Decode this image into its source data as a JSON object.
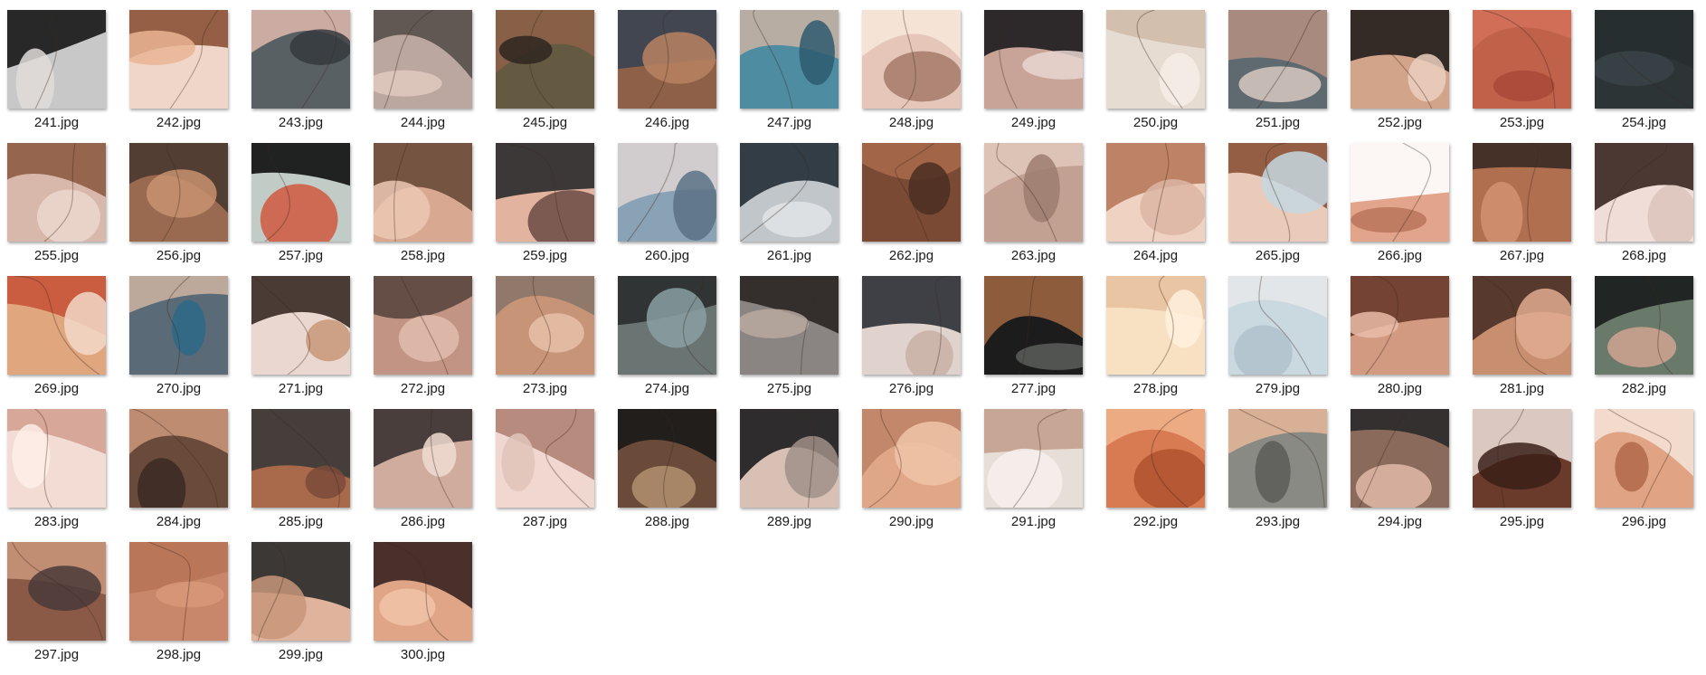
{
  "files": [
    {
      "name": "241.jpg",
      "colors": [
        "#c8c8c8",
        "#161616",
        "#e0dcd8"
      ],
      "icon": "face-thumbnail-icon"
    },
    {
      "name": "242.jpg",
      "colors": [
        "#f0d6c8",
        "#8a5236",
        "#eab494"
      ],
      "icon": "face-thumbnail-icon"
    },
    {
      "name": "243.jpg",
      "colors": [
        "#596064",
        "#d8b4a8",
        "#353a3e"
      ],
      "icon": "face-thumbnail-icon"
    },
    {
      "name": "244.jpg",
      "colors": [
        "#bca6a0",
        "#57504a",
        "#e0cac0"
      ],
      "icon": "face-thumbnail-icon"
    },
    {
      "name": "245.jpg",
      "colors": [
        "#645a42",
        "#8b6048",
        "#2e2620"
      ],
      "icon": "face-thumbnail-icon"
    },
    {
      "name": "246.jpg",
      "colors": [
        "#8e6048",
        "#3a4452",
        "#b88262"
      ],
      "icon": "face-thumbnail-icon"
    },
    {
      "name": "247.jpg",
      "colors": [
        "#4e8ca2",
        "#c4b0a2",
        "#2e5a6e"
      ],
      "icon": "face-thumbnail-icon"
    },
    {
      "name": "248.jpg",
      "colors": [
        "#e6c6b8",
        "#f6e6d8",
        "#a47a6a"
      ],
      "icon": "face-thumbnail-icon"
    },
    {
      "name": "249.jpg",
      "colors": [
        "#c8a498",
        "#1c1c1e",
        "#e8d6d0"
      ],
      "icon": "face-thumbnail-icon"
    },
    {
      "name": "250.jpg",
      "colors": [
        "#e6dcd2",
        "#cfbba8",
        "#f6eee8"
      ],
      "icon": "face-thumbnail-icon"
    },
    {
      "name": "251.jpg",
      "colors": [
        "#5e6a70",
        "#b08e80",
        "#d8c8c0"
      ],
      "icon": "face-thumbnail-icon"
    },
    {
      "name": "252.jpg",
      "colors": [
        "#d2a48a",
        "#221e1c",
        "#ecd0c0"
      ],
      "icon": "face-thumbnail-icon"
    },
    {
      "name": "253.jpg",
      "colors": [
        "#c0614a",
        "#d2705a",
        "#a84a38"
      ],
      "icon": "face-thumbnail-icon"
    },
    {
      "name": "254.jpg",
      "colors": [
        "#2c3436",
        "#262e30",
        "#3a4448"
      ],
      "icon": "face-thumbnail-icon"
    },
    {
      "name": "255.jpg",
      "colors": [
        "#d8b8aa",
        "#8e5c44",
        "#ecd6cc"
      ],
      "icon": "face-thumbnail-icon"
    },
    {
      "name": "256.jpg",
      "colors": [
        "#9a6a50",
        "#4a3a30",
        "#c89270"
      ],
      "icon": "face-thumbnail-icon"
    },
    {
      "name": "257.jpg",
      "colors": [
        "#c2ccc6",
        "#0e0e0e",
        "#d0573e"
      ],
      "icon": "face-thumbnail-icon"
    },
    {
      "name": "258.jpg",
      "colors": [
        "#d8a890",
        "#6a4a3a",
        "#ecc8b4"
      ],
      "icon": "face-thumbnail-icon"
    },
    {
      "name": "259.jpg",
      "colors": [
        "#e2b4a0",
        "#2a2a2c",
        "#6a4a44"
      ],
      "icon": "face-thumbnail-icon"
    },
    {
      "name": "260.jpg",
      "colors": [
        "#8aa2b6",
        "#d8d2d0",
        "#5a7286"
      ],
      "icon": "face-thumbnail-icon"
    },
    {
      "name": "261.jpg",
      "colors": [
        "#c0c6ca",
        "#242e36",
        "#e0e4e6"
      ],
      "icon": "face-thumbnail-icon"
    },
    {
      "name": "262.jpg",
      "colors": [
        "#7a4a34",
        "#a6684a",
        "#4a2e22"
      ],
      "icon": "face-thumbnail-icon"
    },
    {
      "name": "263.jpg",
      "colors": [
        "#c2a092",
        "#e0c6ba",
        "#9c7c70"
      ],
      "icon": "face-thumbnail-icon"
    },
    {
      "name": "264.jpg",
      "colors": [
        "#f0d2c2",
        "#b87a5c",
        "#dcb6a4"
      ],
      "icon": "face-thumbnail-icon"
    },
    {
      "name": "265.jpg",
      "colors": [
        "#eacab8",
        "#8a5236",
        "#c6d8e0"
      ],
      "icon": "face-thumbnail-icon"
    },
    {
      "name": "266.jpg",
      "colors": [
        "#e2a48a",
        "#ffffff",
        "#b8765a"
      ],
      "icon": "face-thumbnail-icon"
    },
    {
      "name": "267.jpg",
      "colors": [
        "#b07050",
        "#3a2a24",
        "#d29272"
      ],
      "icon": "face-thumbnail-icon"
    },
    {
      "name": "268.jpg",
      "colors": [
        "#f0ddd8",
        "#3a2620",
        "#dcc4bc"
      ],
      "icon": "face-thumbnail-icon"
    },
    {
      "name": "269.jpg",
      "colors": [
        "#e0a67e",
        "#c8543a",
        "#f2d8c8"
      ],
      "icon": "face-thumbnail-icon"
    },
    {
      "name": "270.jpg",
      "colors": [
        "#5a6a76",
        "#c8b0a0",
        "#2e6888"
      ],
      "icon": "face-thumbnail-icon"
    },
    {
      "name": "271.jpg",
      "colors": [
        "#ead8d0",
        "#3a2a24",
        "#c89878"
      ],
      "icon": "face-thumbnail-icon"
    },
    {
      "name": "272.jpg",
      "colors": [
        "#c29484",
        "#5a463e",
        "#e0bcac"
      ],
      "icon": "face-thumbnail-icon"
    },
    {
      "name": "273.jpg",
      "colors": [
        "#c89478",
        "#8a7468",
        "#e6c0a8"
      ],
      "icon": "face-thumbnail-icon"
    },
    {
      "name": "274.jpg",
      "colors": [
        "#6a7472",
        "#2a2e2e",
        "#8aa0a4"
      ],
      "icon": "face-thumbnail-icon"
    },
    {
      "name": "275.jpg",
      "colors": [
        "#8a8482",
        "#2a2624",
        "#b8a8a0"
      ],
      "icon": "face-thumbnail-icon"
    },
    {
      "name": "276.jpg",
      "colors": [
        "#e0d2cc",
        "#2e3036",
        "#c8b0a4"
      ],
      "icon": "face-thumbnail-icon"
    },
    {
      "name": "277.jpg",
      "colors": [
        "#1c1c1c",
        "#9a6440",
        "#5a5e5a"
      ],
      "icon": "face-thumbnail-icon"
    },
    {
      "name": "278.jpg",
      "colors": [
        "#f8e0c2",
        "#e8c2a0",
        "#fff0de"
      ],
      "icon": "face-thumbnail-icon"
    },
    {
      "name": "279.jpg",
      "colors": [
        "#cad8e0",
        "#e6e8ea",
        "#b0c2cc"
      ],
      "icon": "face-thumbnail-icon"
    },
    {
      "name": "280.jpg",
      "colors": [
        "#d29a80",
        "#6a3a2a",
        "#eabca8"
      ],
      "icon": "face-thumbnail-icon"
    },
    {
      "name": "281.jpg",
      "colors": [
        "#c88e70",
        "#4a3026",
        "#e0ac90"
      ],
      "icon": "face-thumbnail-icon"
    },
    {
      "name": "282.jpg",
      "colors": [
        "#6a7a6a",
        "#1a1c1c",
        "#d0a492"
      ],
      "icon": "face-thumbnail-icon"
    },
    {
      "name": "283.jpg",
      "colors": [
        "#f2dcd4",
        "#d4a294",
        "#ffeee8"
      ],
      "icon": "face-thumbnail-icon"
    },
    {
      "name": "284.jpg",
      "colors": [
        "#6a4a3a",
        "#c89478",
        "#3a2a24"
      ],
      "icon": "face-thumbnail-icon"
    },
    {
      "name": "285.jpg",
      "colors": [
        "#a86a4a",
        "#3a3a3a",
        "#7a4a3a"
      ],
      "icon": "face-thumbnail-icon"
    },
    {
      "name": "286.jpg",
      "colors": [
        "#d0ac9e",
        "#3a3230",
        "#f0dcd2"
      ],
      "icon": "face-thumbnail-icon"
    },
    {
      "name": "287.jpg",
      "colors": [
        "#f0d8d0",
        "#b08474",
        "#e0c4b8"
      ],
      "icon": "face-thumbnail-icon"
    },
    {
      "name": "288.jpg",
      "colors": [
        "#6a4a38",
        "#1a1a1a",
        "#b09070"
      ],
      "icon": "face-thumbnail-icon"
    },
    {
      "name": "289.jpg",
      "colors": [
        "#d8c0b4",
        "#1c1c1e",
        "#a09088"
      ],
      "icon": "face-thumbnail-icon"
    },
    {
      "name": "290.jpg",
      "colors": [
        "#e0a688",
        "#c08468",
        "#f0c4a8"
      ],
      "icon": "face-thumbnail-icon"
    },
    {
      "name": "291.jpg",
      "colors": [
        "#e8ded8",
        "#c4a08e",
        "#f6f0ec"
      ],
      "icon": "face-thumbnail-icon"
    },
    {
      "name": "292.jpg",
      "colors": [
        "#d87a52",
        "#f0b08a",
        "#b0522e"
      ],
      "icon": "face-thumbnail-icon"
    },
    {
      "name": "293.jpg",
      "colors": [
        "#8a8a84",
        "#e0b498",
        "#5a5a58"
      ],
      "icon": "face-thumbnail-icon"
    },
    {
      "name": "294.jpg",
      "colors": [
        "#8a6a5a",
        "#2a2a2a",
        "#e0b8a8"
      ],
      "icon": "face-thumbnail-icon"
    },
    {
      "name": "295.jpg",
      "colors": [
        "#6a3a2a",
        "#e8d8d0",
        "#3a2018"
      ],
      "icon": "face-thumbnail-icon"
    },
    {
      "name": "296.jpg",
      "colors": [
        "#e0a484",
        "#f4e0d4",
        "#b06a4a"
      ],
      "icon": "face-thumbnail-icon"
    },
    {
      "name": "297.jpg",
      "colors": [
        "#8a5a46",
        "#c89478",
        "#4a3a3a"
      ],
      "icon": "face-thumbnail-icon"
    },
    {
      "name": "298.jpg",
      "colors": [
        "#c8866a",
        "#b87458",
        "#d89878"
      ],
      "icon": "face-thumbnail-icon"
    },
    {
      "name": "299.jpg",
      "colors": [
        "#e0b49c",
        "#2a2a2a",
        "#c8967a"
      ],
      "icon": "face-thumbnail-icon"
    },
    {
      "name": "300.jpg",
      "colors": [
        "#e0a486",
        "#3a2420",
        "#f0c4a8"
      ],
      "icon": "face-thumbnail-icon"
    }
  ]
}
